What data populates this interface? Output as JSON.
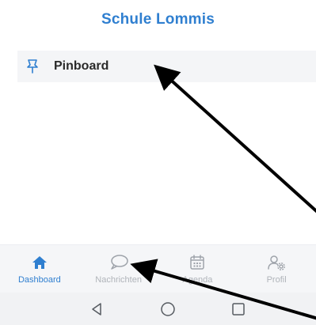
{
  "header": {
    "title": "Schule Lommis"
  },
  "main": {
    "items": [
      {
        "icon": "pushpin-icon",
        "label": "Pinboard"
      }
    ]
  },
  "tabbar": {
    "tabs": [
      {
        "label": "Dashboard",
        "icon": "home-icon",
        "active": true
      },
      {
        "label": "Nachrichten",
        "icon": "chat-bubble-icon",
        "active": false
      },
      {
        "label": "Agenda",
        "icon": "calendar-icon",
        "active": false
      },
      {
        "label": "Profil",
        "icon": "user-settings-icon",
        "active": false
      }
    ]
  },
  "system_nav": {
    "buttons": [
      "back-icon",
      "home-circle-icon",
      "recents-icon"
    ]
  },
  "colors": {
    "accent": "#2f7fd0",
    "inactive": "#b0b4ba",
    "row_background": "#f4f5f7",
    "arrow": "#000000"
  }
}
